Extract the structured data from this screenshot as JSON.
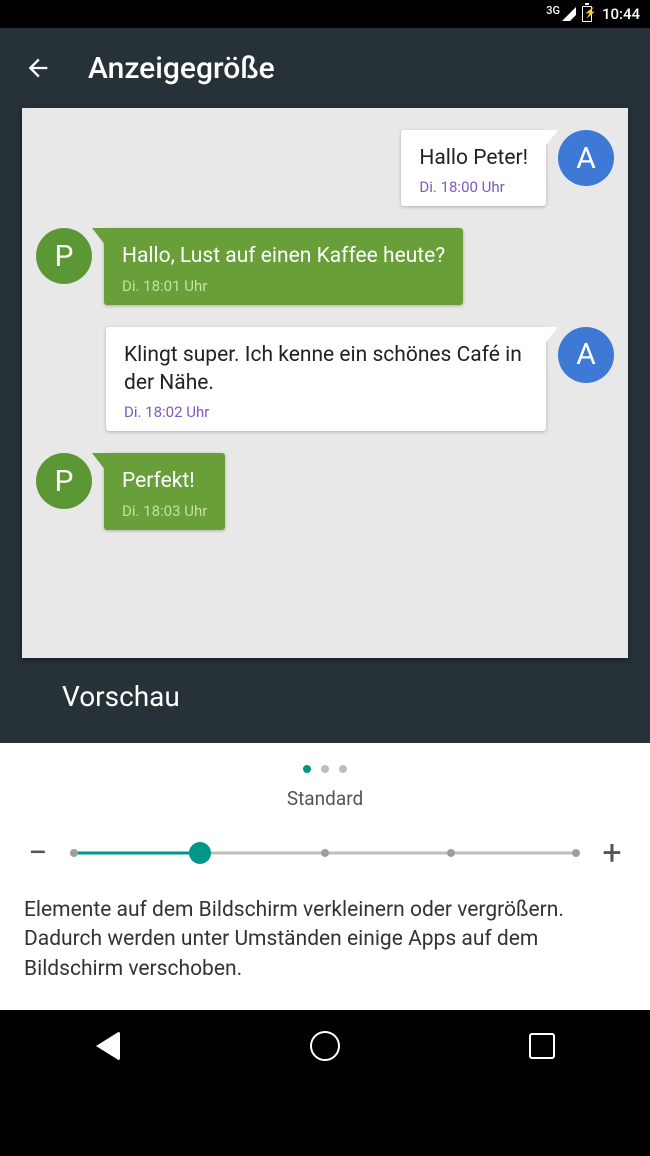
{
  "status": {
    "network": "3G",
    "clock": "10:44"
  },
  "header": {
    "title": "Anzeigegröße"
  },
  "chat": {
    "avatarA": "A",
    "avatarP": "P",
    "messages": [
      {
        "text": "Hallo Peter!",
        "ts": "Di. 18:00 Uhr"
      },
      {
        "text": "Hallo, Lust auf einen Kaffee heute?",
        "ts": "Di. 18:01 Uhr"
      },
      {
        "text": "Klingt super. Ich kenne ein schönes Café in der Nähe.",
        "ts": "Di. 18:02 Uhr"
      },
      {
        "text": "Perfekt!",
        "ts": "Di. 18:03 Uhr"
      }
    ]
  },
  "preview_label": "Vorschau",
  "size": {
    "label": "Standard",
    "minus": "−",
    "plus": "+",
    "steps": 5,
    "selected_index": 1
  },
  "description": "Elemente auf dem Bildschirm verkleinern oder vergrößern. Dadurch werden unter Umständen einige Apps auf dem Bildschirm verschoben.",
  "colors": {
    "teal": "#009688",
    "green": "#689f38",
    "blue": "#3e79d6",
    "darkbg": "#263238"
  }
}
